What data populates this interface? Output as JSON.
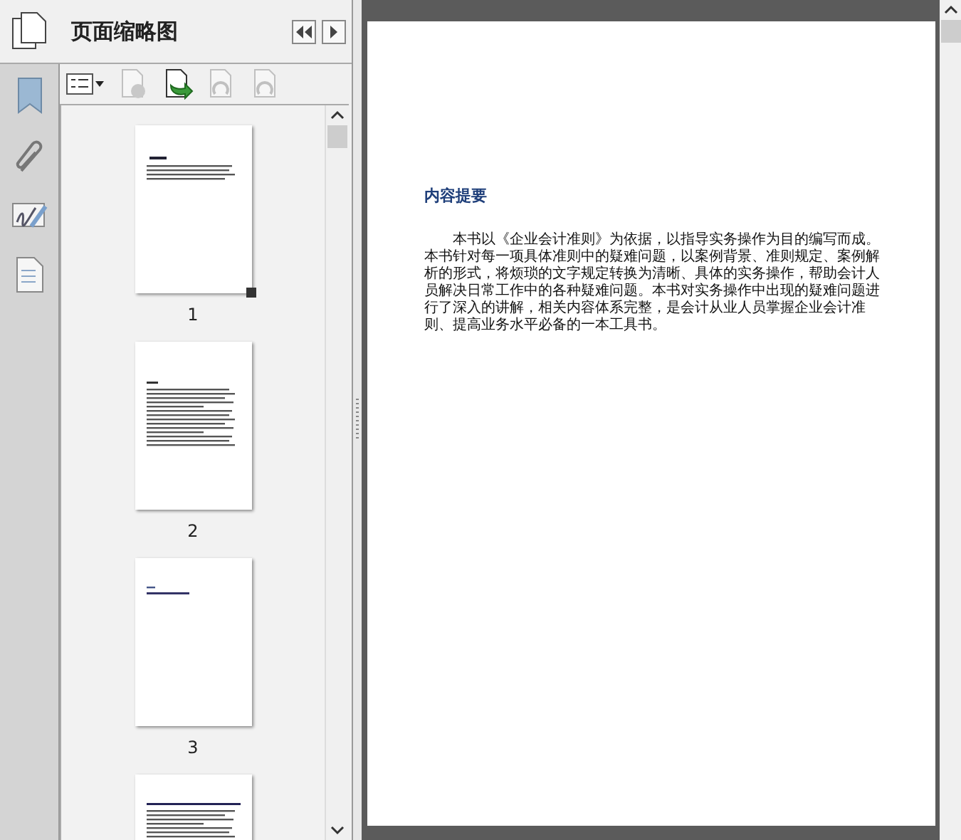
{
  "panel": {
    "title": "页面缩略图"
  },
  "thumbnails": [
    {
      "label": "1",
      "selected": true
    },
    {
      "label": "2",
      "selected": false
    },
    {
      "label": "3",
      "selected": false
    },
    {
      "selected": false
    }
  ],
  "document": {
    "heading": "内容提要",
    "paragraph": "本书以《企业会计准则》为依据，以指导实务操作为目的编写而成。本书针对每一项具体准则中的疑难问题，以案例背景、准则规定、案例解析的形式，将烦琐的文字规定转换为清晰、具体的实务操作，帮助会计人员解决日常工作中的各种疑难问题。本书对实务操作中出现的疑难问题进行了深入的讲解，相关内容体系完整，是会计从业人员掌握企业会计准则、提高业务水平必备的一本工具书。"
  }
}
